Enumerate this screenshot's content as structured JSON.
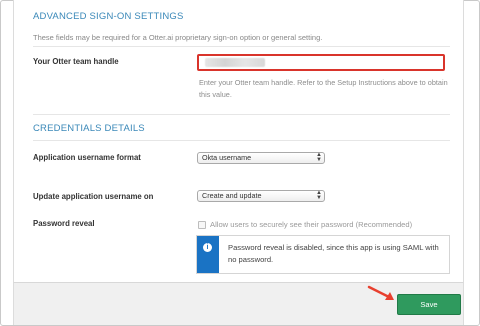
{
  "advanced": {
    "title": "ADVANCED SIGN-ON SETTINGS",
    "description": "These fields may be required for a Otter.ai proprietary sign-on option or general setting.",
    "team_handle_label": "Your Otter team handle",
    "team_handle_help": "Enter your Otter team handle. Refer to the Setup Instructions above to obtain this value."
  },
  "credentials": {
    "title": "CREDENTIALS DETAILS",
    "username_format_label": "Application username format",
    "username_format_value": "Okta username",
    "update_on_label": "Update application username on",
    "update_on_value": "Create and update",
    "password_reveal_label": "Password reveal",
    "password_reveal_checkbox": "Allow users to securely see their password (Recommended)",
    "password_reveal_checked": false,
    "info_message": "Password reveal is disabled, since this app is using SAML with no password."
  },
  "footer": {
    "save_label": "Save"
  },
  "colors": {
    "section_title": "#3a88b8",
    "highlight_border": "#d9342b",
    "info_accent": "#1a73c4",
    "save_button": "#2f9a5e",
    "annotation_arrow": "#e8402f"
  },
  "icons": {
    "info": "info-icon",
    "select_arrows": "updown-arrows-icon"
  }
}
